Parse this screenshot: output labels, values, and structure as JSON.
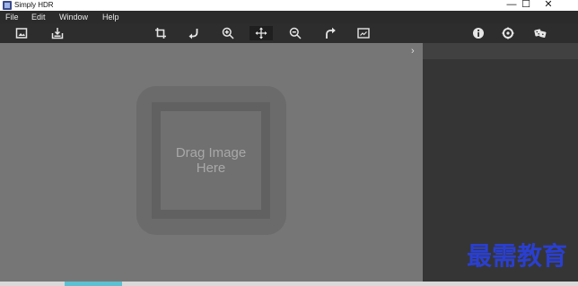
{
  "window": {
    "title": "Simply HDR",
    "controls": {
      "minimize": "—",
      "maximize": "☐",
      "close": "✕"
    }
  },
  "menu": {
    "items": [
      {
        "label": "File"
      },
      {
        "label": "Edit"
      },
      {
        "label": "Window"
      },
      {
        "label": "Help"
      }
    ]
  },
  "toolbar": {
    "tools": [
      {
        "icon": "open-image-icon"
      },
      {
        "icon": "save-icon"
      },
      {
        "icon": "crop-icon"
      },
      {
        "icon": "rotate-left-icon"
      },
      {
        "icon": "zoom-in-icon"
      },
      {
        "icon": "move-icon",
        "active": true
      },
      {
        "icon": "zoom-out-icon"
      },
      {
        "icon": "rotate-right-icon"
      },
      {
        "icon": "fit-screen-icon"
      },
      {
        "icon": "info-icon"
      },
      {
        "icon": "settings-icon"
      },
      {
        "icon": "random-dice-icon"
      }
    ]
  },
  "canvas": {
    "drop_text": "Drag Image\nHere",
    "panel_toggle": "›"
  },
  "watermark": {
    "text": "最需教育"
  },
  "colors": {
    "menubar": "#2b2b2b",
    "toolbar": "#2d2d2d",
    "canvas": "#767676",
    "side_panel": "#353535",
    "status_accent": "#5bc1d2",
    "watermark": "#2a3fd0"
  }
}
